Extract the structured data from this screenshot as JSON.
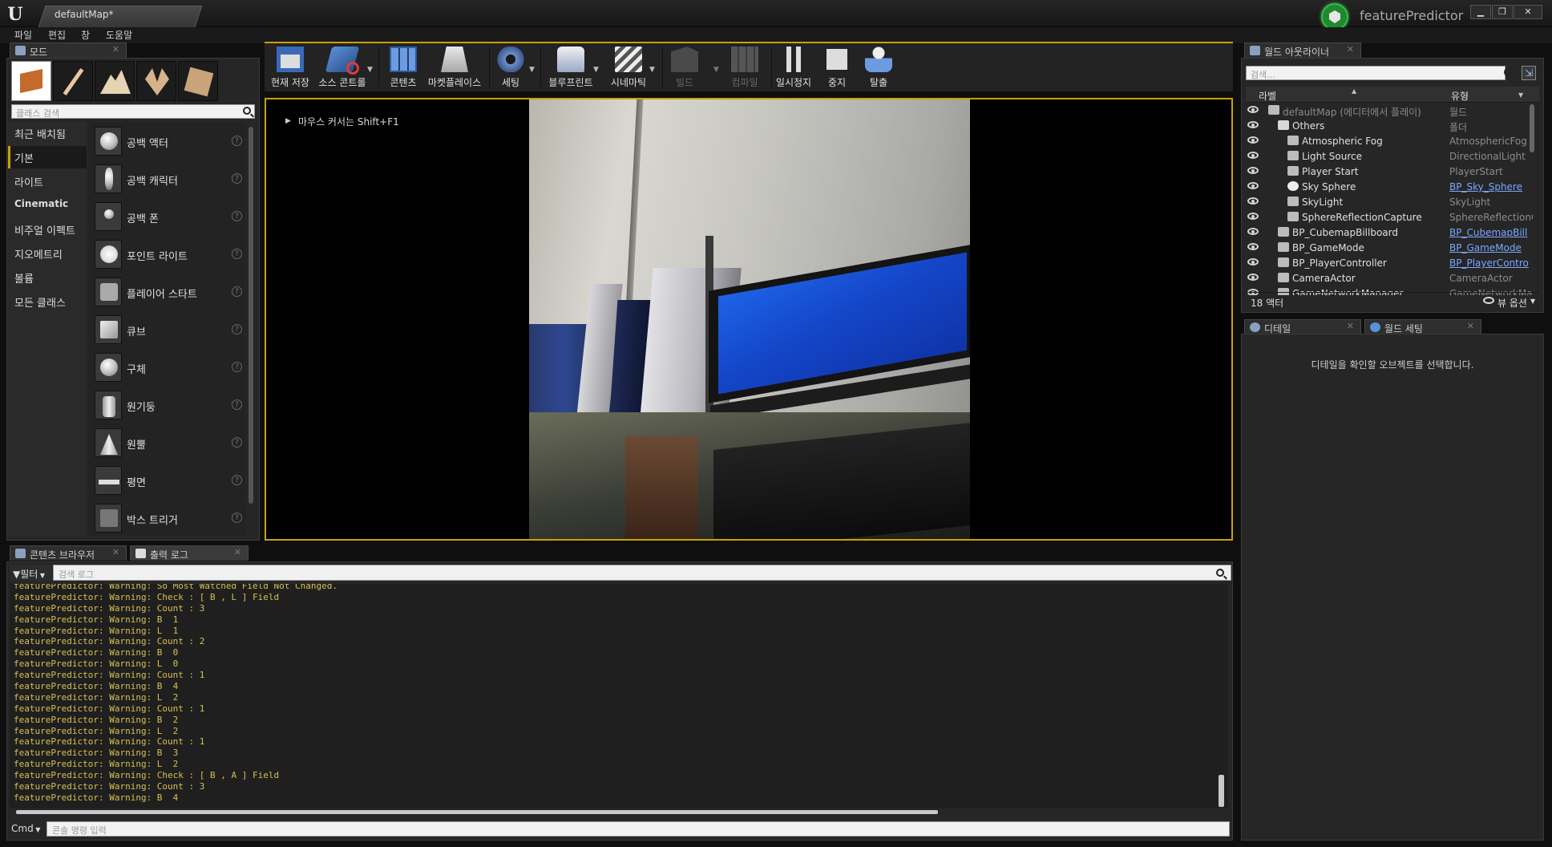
{
  "titlebar": {
    "doc_tab": "defaultMap*",
    "project": "featurePredictor",
    "min": "▁",
    "max": "❐",
    "close": "✕",
    "brand_color": "#1f8a2d"
  },
  "menu": [
    "파일",
    "편집",
    "창",
    "도움말"
  ],
  "modes": {
    "tab": "모드",
    "search_placeholder": "클래스 검색",
    "categories": [
      "최근 배치됨",
      "기본",
      "라이트",
      "Cinematic",
      "비주얼 이펙트",
      "지오메트리",
      "볼륨",
      "모든 클래스"
    ],
    "selected_category": "기본",
    "items": [
      "공백 액터",
      "공백 캐릭터",
      "공백 폰",
      "포인트 라이트",
      "플레이어 스타트",
      "큐브",
      "구체",
      "원기둥",
      "원뿔",
      "평면",
      "박스 트리거"
    ],
    "mode_buttons": [
      "place-mode-icon",
      "paint-mode-icon",
      "landscape-mode-icon",
      "foliage-mode-icon",
      "geometry-mode-icon"
    ]
  },
  "toolbar": {
    "buttons": [
      {
        "label": "현재 저장",
        "icon": "save-icon",
        "enabled": true
      },
      {
        "label": "소스 콘트롤",
        "icon": "source-control-icon",
        "enabled": true
      },
      {
        "label": "콘텐츠",
        "icon": "content-icon",
        "enabled": true
      },
      {
        "label": "마켓플레이스",
        "icon": "marketplace-icon",
        "enabled": true
      },
      {
        "label": "세팅",
        "icon": "settings-icon",
        "enabled": true
      },
      {
        "label": "블루프린트",
        "icon": "blueprint-icon",
        "enabled": true
      },
      {
        "label": "시네마틱",
        "icon": "cinematics-icon",
        "enabled": true
      },
      {
        "label": "빌드",
        "icon": "build-icon",
        "enabled": false
      },
      {
        "label": "컴파일",
        "icon": "compile-icon",
        "enabled": false
      },
      {
        "label": "일시정지",
        "icon": "pause-icon",
        "enabled": true
      },
      {
        "label": "중지",
        "icon": "stop-icon",
        "enabled": true
      },
      {
        "label": "탈출",
        "icon": "eject-icon",
        "enabled": true
      }
    ],
    "accent": "#c9a200"
  },
  "viewport": {
    "hint": "마우스 커서는 Shift+F1"
  },
  "outliner": {
    "tab": "월드 아웃라이너",
    "search_placeholder": "검색...",
    "col_label": "라벨",
    "col_type": "유형",
    "rows": [
      {
        "name": "defaultMap (에디터에서 플레이)",
        "type": "월드",
        "link": false,
        "indent": 0,
        "dim": true
      },
      {
        "name": "Others",
        "type": "폴더",
        "link": false,
        "indent": 1,
        "dim": false
      },
      {
        "name": "Atmospheric Fog",
        "type": "AtmosphericFog",
        "link": false,
        "indent": 2
      },
      {
        "name": "Light Source",
        "type": "DirectionalLight",
        "link": false,
        "indent": 2
      },
      {
        "name": "Player Start",
        "type": "PlayerStart",
        "link": false,
        "indent": 2
      },
      {
        "name": "Sky Sphere",
        "type": "BP_Sky_Sphere",
        "link": true,
        "indent": 2
      },
      {
        "name": "SkyLight",
        "type": "SkyLight",
        "link": false,
        "indent": 2
      },
      {
        "name": "SphereReflectionCapture",
        "type": "SphereReflectionC",
        "link": false,
        "indent": 2
      },
      {
        "name": "BP_CubemapBillboard",
        "type": "BP_CubemapBill",
        "link": true,
        "indent": 1
      },
      {
        "name": "BP_GameMode",
        "type": "BP_GameMode",
        "link": true,
        "indent": 1
      },
      {
        "name": "BP_PlayerController",
        "type": "BP_PlayerContro",
        "link": true,
        "indent": 1
      },
      {
        "name": "CameraActor",
        "type": "CameraActor",
        "link": false,
        "indent": 1
      },
      {
        "name": "GameNetworkManager",
        "type": "GameNetworkMar",
        "link": false,
        "indent": 1
      }
    ],
    "actor_count": "18 액터",
    "view_options": "뷰 옵션"
  },
  "details": {
    "tab": "디테일",
    "tab2": "월드 세팅",
    "message": "디테일을 확인할 오브젝트를 선택합니다."
  },
  "log": {
    "tab_content": "콘텐츠 브라우저",
    "tab_output": "출력 로그",
    "filter": "필터",
    "search_placeholder": "검색 로그",
    "lines": [
      "featurePredictor: Warning: So Most Watched Field Not Changed.",
      "featurePredictor: Warning: Check : [ B , L ] Field",
      "featurePredictor: Warning: Count : 3",
      "featurePredictor: Warning: B  1",
      "featurePredictor: Warning: L  1",
      "featurePredictor: Warning: Count : 2",
      "featurePredictor: Warning: B  0",
      "featurePredictor: Warning: L  0",
      "featurePredictor: Warning: Count : 1",
      "featurePredictor: Warning: B  4",
      "featurePredictor: Warning: L  2",
      "featurePredictor: Warning: Count : 1",
      "featurePredictor: Warning: B  2",
      "featurePredictor: Warning: L  2",
      "featurePredictor: Warning: Count : 1",
      "featurePredictor: Warning: B  3",
      "featurePredictor: Warning: L  2",
      "featurePredictor: Warning: Check : [ B , A ] Field",
      "featurePredictor: Warning: Count : 3",
      "featurePredictor: Warning: B  4"
    ],
    "cmd_label": "Cmd",
    "cmd_placeholder": "콘솔 명령 입력"
  }
}
